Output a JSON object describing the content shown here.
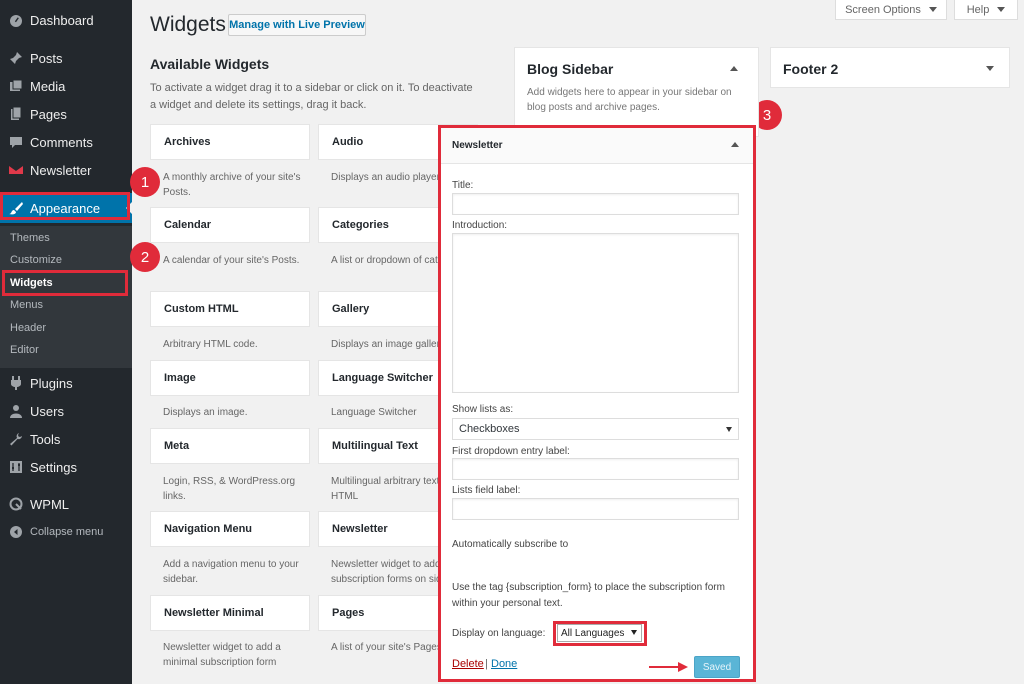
{
  "sidebar": {
    "items": [
      {
        "label": "Dashboard",
        "icon": "dashboard-icon"
      },
      {
        "label": "Posts",
        "icon": "pin-icon"
      },
      {
        "label": "Media",
        "icon": "media-icon"
      },
      {
        "label": "Pages",
        "icon": "pages-icon"
      },
      {
        "label": "Comments",
        "icon": "comment-icon"
      },
      {
        "label": "Newsletter",
        "icon": "newsletter-icon"
      },
      {
        "label": "Appearance",
        "icon": "brush-icon"
      },
      {
        "label": "Plugins",
        "icon": "plugin-icon"
      },
      {
        "label": "Users",
        "icon": "user-icon"
      },
      {
        "label": "Tools",
        "icon": "wrench-icon"
      },
      {
        "label": "Settings",
        "icon": "settings-icon"
      },
      {
        "label": "WPML",
        "icon": "wpml-icon"
      },
      {
        "label": "Collapse menu",
        "icon": "collapse-icon"
      }
    ],
    "submenu": [
      "Themes",
      "Customize",
      "Widgets",
      "Menus",
      "Header",
      "Editor"
    ]
  },
  "badges": [
    "1",
    "2",
    "3"
  ],
  "header": {
    "title": "Widgets",
    "live_preview": "Manage with Live Preview",
    "screen_options": "Screen Options",
    "help": "Help"
  },
  "available": {
    "title": "Available Widgets",
    "description": "To activate a widget drag it to a sidebar or click on it. To deactivate a widget and delete its settings, drag it back.",
    "left": [
      {
        "name": "Archives",
        "desc": "A monthly archive of your site's Posts."
      },
      {
        "name": "Calendar",
        "desc": "A calendar of your site's Posts."
      },
      {
        "name": "Custom HTML",
        "desc": "Arbitrary HTML code."
      },
      {
        "name": "Image",
        "desc": "Displays an image."
      },
      {
        "name": "Meta",
        "desc": "Login, RSS, & WordPress.org links."
      },
      {
        "name": "Navigation Menu",
        "desc": "Add a navigation menu to your sidebar."
      },
      {
        "name": "Newsletter Minimal",
        "desc": "Newsletter widget to add a minimal subscription form"
      }
    ],
    "right": [
      {
        "name": "Audio",
        "desc": "Displays an audio player."
      },
      {
        "name": "Categories",
        "desc": "A list or dropdown of categories."
      },
      {
        "name": "Gallery",
        "desc": "Displays an image gallery."
      },
      {
        "name": "Language Switcher",
        "desc": "Language Switcher"
      },
      {
        "name": "Multilingual Text",
        "desc": "Multilingual arbitrary text or HTML"
      },
      {
        "name": "Newsletter",
        "desc": "Newsletter widget to add subscription forms on sidebars"
      },
      {
        "name": "Pages",
        "desc": "A list of your site's Pages."
      }
    ]
  },
  "blog_sidebar": {
    "title": "Blog Sidebar",
    "desc": "Add widgets here to appear in your sidebar on blog posts and archive pages."
  },
  "footer2": {
    "title": "Footer 2"
  },
  "newsletter_form": {
    "title": "Newsletter",
    "title_label": "Title:",
    "intro_label": "Introduction:",
    "show_lists_label": "Show lists as:",
    "show_lists_value": "Checkboxes",
    "first_dropdown_label": "First dropdown entry label:",
    "lists_field_label": "Lists field label:",
    "auto_subscribe": "Automatically subscribe to",
    "tag_note": "Use the tag {subscription_form} to place the subscription form within your personal text.",
    "display_lang_label": "Display on language:",
    "display_lang_value": "All Languages",
    "delete": "Delete",
    "sep": "|",
    "done": "Done",
    "saved": "Saved"
  },
  "colors": {
    "accent": "#0073aa",
    "highlight": "#e02b3a",
    "sidebar_bg": "#23282d"
  }
}
